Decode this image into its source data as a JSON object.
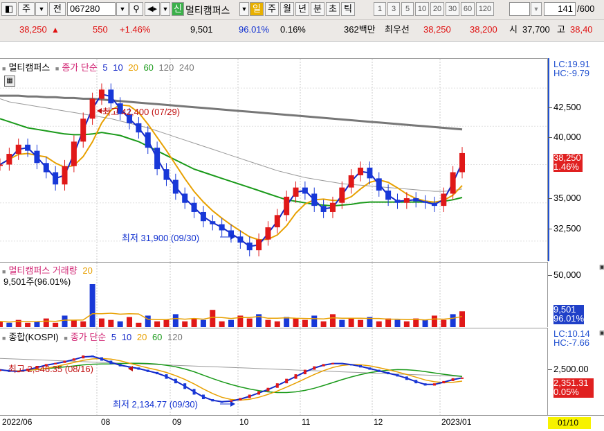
{
  "toolbar": {
    "period_select": "주",
    "prev_label": "전",
    "code": "067280",
    "search_icon": "search-icon",
    "sound_icon": "speaker-icon",
    "new_badge": "신",
    "stock_name": "멀티캠퍼스",
    "periods": [
      "일",
      "주",
      "월",
      "년",
      "분",
      "초",
      "틱"
    ],
    "active_period": "일",
    "minute_buttons": [
      "1",
      "3",
      "5",
      "10",
      "20",
      "30",
      "60",
      "120"
    ],
    "count": "141",
    "total": "/600"
  },
  "quote": {
    "price": "38,250",
    "up_arrow": "▲",
    "change": "550",
    "change_pct": "+1.46%",
    "volume": "9,501",
    "vol_ratio": "96.01%",
    "turnover": "0.16%",
    "amount": "362백만",
    "best_ask_label": "최우선",
    "best_ask": "38,250",
    "best_bid": "38,200",
    "open_label": "시",
    "open": "37,700",
    "high_label": "고",
    "high": "38,40"
  },
  "price_pane": {
    "legend_name": "멀티캠퍼스",
    "ma_label": "종가 단순",
    "ma_periods": [
      "5",
      "10",
      "20",
      "60",
      "120",
      "240"
    ],
    "ma_colors": [
      "#1428c8",
      "#1428c8",
      "#e8a000",
      "#1a9a1a",
      "#777777",
      "#777777"
    ],
    "lc": "LC:19.91",
    "hc": "HC:-9.79",
    "yticks": [
      "42,500",
      "40,000",
      "35,000",
      "32,500"
    ],
    "current_price": "38,250",
    "current_pct": "1.46%",
    "max_annotation": "최고 42,400 (07/29)",
    "min_annotation": "최저 31,900 (09/30)"
  },
  "volume_pane": {
    "legend_name": "멀티캠퍼스 거래량",
    "ma_period": "20",
    "current_text": "9,501주(96.01%)",
    "ytick": "50,000",
    "current_value": "9,501",
    "current_pct": "96.01%"
  },
  "index_pane": {
    "legend_name": "종합(KOSPI)",
    "ma_label": "종가 단순",
    "ma_periods": [
      "5",
      "10",
      "20",
      "60",
      "120"
    ],
    "lc": "LC:10.14",
    "hc": "HC:-7.66",
    "ytick": "2,500.00",
    "current_value": "2,351.31",
    "current_pct": "0.05%",
    "max_annotation": "최고 2,546.35 (08/16)",
    "min_annotation": "최저 2,134.77 (09/30)"
  },
  "xaxis": {
    "labels": [
      "2022/06",
      "08",
      "09",
      "10",
      "11",
      "12",
      "2023/01"
    ],
    "cursor_date": "01/10"
  },
  "chart_data": {
    "type": "candlestick",
    "price_range": [
      31500,
      43500
    ],
    "price_close_series": [
      37500,
      38200,
      38800,
      38400,
      37600,
      37000,
      36200,
      37400,
      39000,
      40500,
      41800,
      42400,
      41500,
      40800,
      40200,
      39600,
      38600,
      37200,
      36500,
      35600,
      35000,
      34400,
      33800,
      33600,
      33200,
      32800,
      32400,
      31900,
      32600,
      33400,
      34200,
      35400,
      36000,
      35600,
      34800,
      34400,
      35000,
      36000,
      36800,
      37300,
      36600,
      35800,
      35200,
      35000,
      35300,
      35100,
      35000,
      34800,
      35600,
      37000,
      38250
    ],
    "ma120_series": [
      41800,
      41600,
      41500,
      41400,
      41300,
      41200,
      41100,
      41000,
      40900,
      40800,
      40700,
      40600,
      40500,
      40350,
      40200,
      40050,
      39900,
      39700,
      39500,
      39300,
      39100,
      38900,
      38700,
      38500,
      38300,
      38100,
      37900,
      37700,
      37500,
      37300,
      37100,
      36950,
      36800,
      36650,
      36550,
      36450,
      36350,
      36250,
      36200,
      36150,
      36100,
      36050,
      36000,
      35950,
      35900,
      35850,
      35800,
      35750,
      35750,
      35800,
      35900
    ],
    "ma240_series": [
      42000,
      42000,
      42000,
      41950,
      41950,
      41900,
      41900,
      41850,
      41850,
      41800,
      41800,
      41750,
      41700,
      41650,
      41600,
      41550,
      41500,
      41450,
      41400,
      41350,
      41300,
      41250,
      41200,
      41150,
      41100,
      41050,
      41000,
      40950,
      40900,
      40850,
      40800,
      40750,
      40700,
      40650,
      40600,
      40550,
      40500,
      40450,
      40400,
      40350,
      40300,
      40250,
      40200,
      40150,
      40100,
      40050,
      40000,
      39950,
      39900,
      39850,
      39800
    ],
    "ma60_series": [
      40500,
      40300,
      40100,
      39900,
      39800,
      39700,
      39600,
      39500,
      39450,
      39450,
      39500,
      39600,
      39500,
      39400,
      39200,
      39000,
      38700,
      38400,
      38100,
      37800,
      37500,
      37200,
      37000,
      36800,
      36600,
      36400,
      36200,
      36000,
      35800,
      35600,
      35400,
      35200,
      35100,
      35000,
      34900,
      34850,
      34800,
      34850,
      34900,
      35000,
      35050,
      35050,
      35050,
      35050,
      35050,
      35050,
      35050,
      35050,
      35100,
      35200,
      35350
    ],
    "volume_values": [
      4,
      3,
      5,
      3,
      4,
      6,
      3,
      8,
      5,
      4,
      30,
      6,
      5,
      4,
      7,
      3,
      8,
      4,
      5,
      9,
      4,
      6,
      5,
      12,
      4,
      5,
      8,
      6,
      9,
      5,
      4,
      7,
      6,
      5,
      8,
      4,
      9,
      5,
      6,
      5,
      7,
      4,
      6,
      5,
      4,
      6,
      5,
      8,
      5,
      9,
      11
    ],
    "volume_range": [
      0,
      52000
    ],
    "kospi_close_series": [
      2420,
      2400,
      2410,
      2430,
      2450,
      2470,
      2480,
      2500,
      2520,
      2546,
      2530,
      2500,
      2470,
      2450,
      2440,
      2420,
      2400,
      2380,
      2340,
      2300,
      2250,
      2200,
      2160,
      2140,
      2135,
      2150,
      2170,
      2200,
      2230,
      2260,
      2300,
      2340,
      2380,
      2420,
      2450,
      2470,
      2480,
      2470,
      2460,
      2440,
      2420,
      2400,
      2380,
      2360,
      2330,
      2300,
      2280,
      2300,
      2320,
      2345,
      2351
    ],
    "kospi_range": [
      2050,
      2650
    ]
  }
}
